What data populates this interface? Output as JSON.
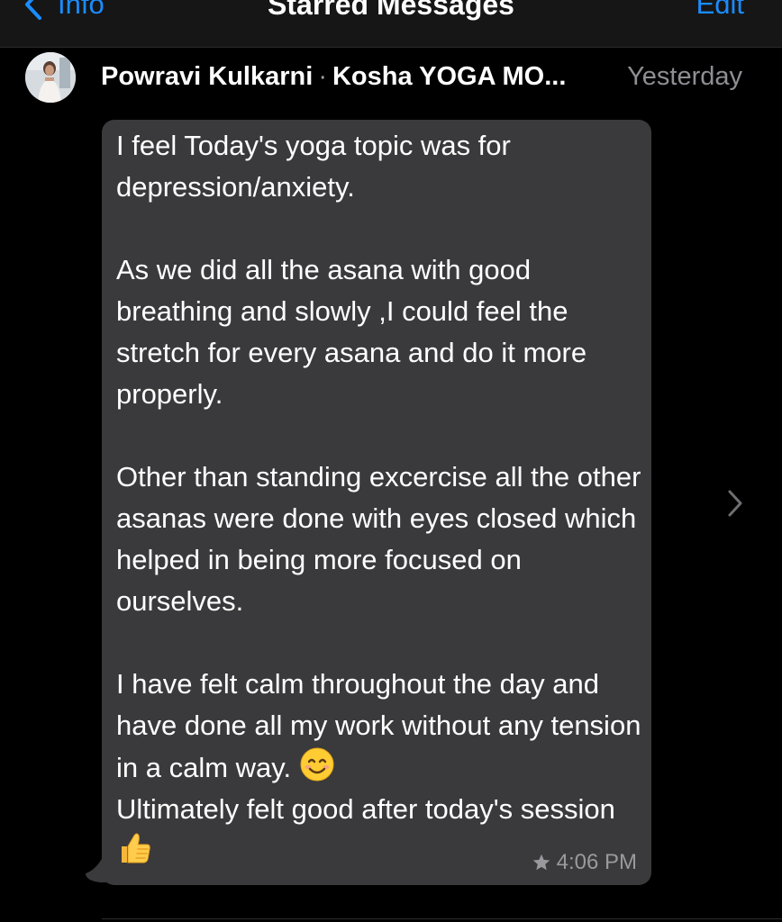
{
  "nav": {
    "back_label": "Info",
    "title": "Starred Messages",
    "edit_label": "Edit"
  },
  "message": {
    "sender": "Powravi Kulkarni",
    "separator": "·",
    "group": "Kosha YOGA MO...",
    "date": "Yesterday",
    "paragraphs": {
      "p1": "I feel Today's yoga topic was for depression/anxiety.",
      "p2": "As we did all the asana with good breathing and slowly ,I could feel the stretch for every asana and do it more properly.",
      "p3": "Other than standing excercise all the other asanas were done with eyes closed which helped in being more focused on ourselves.",
      "p4a": "I have felt calm throughout the day and have done all my work without any tension in a calm way.",
      "p4b": "Ultimately felt good after today's session"
    },
    "time": "4:06 PM",
    "starred": true
  },
  "icons": {
    "back": "chevron-left-icon",
    "avatar": "avatar",
    "star": "star-icon",
    "smile_emoji": "smiling-face-emoji",
    "thumbs_up_emoji": "thumbs-up-emoji",
    "detail": "chevron-right-icon"
  },
  "colors": {
    "accent": "#1a8cff",
    "background": "#000000",
    "bubble": "#3a3a3c",
    "meta": "#8e8e93"
  }
}
